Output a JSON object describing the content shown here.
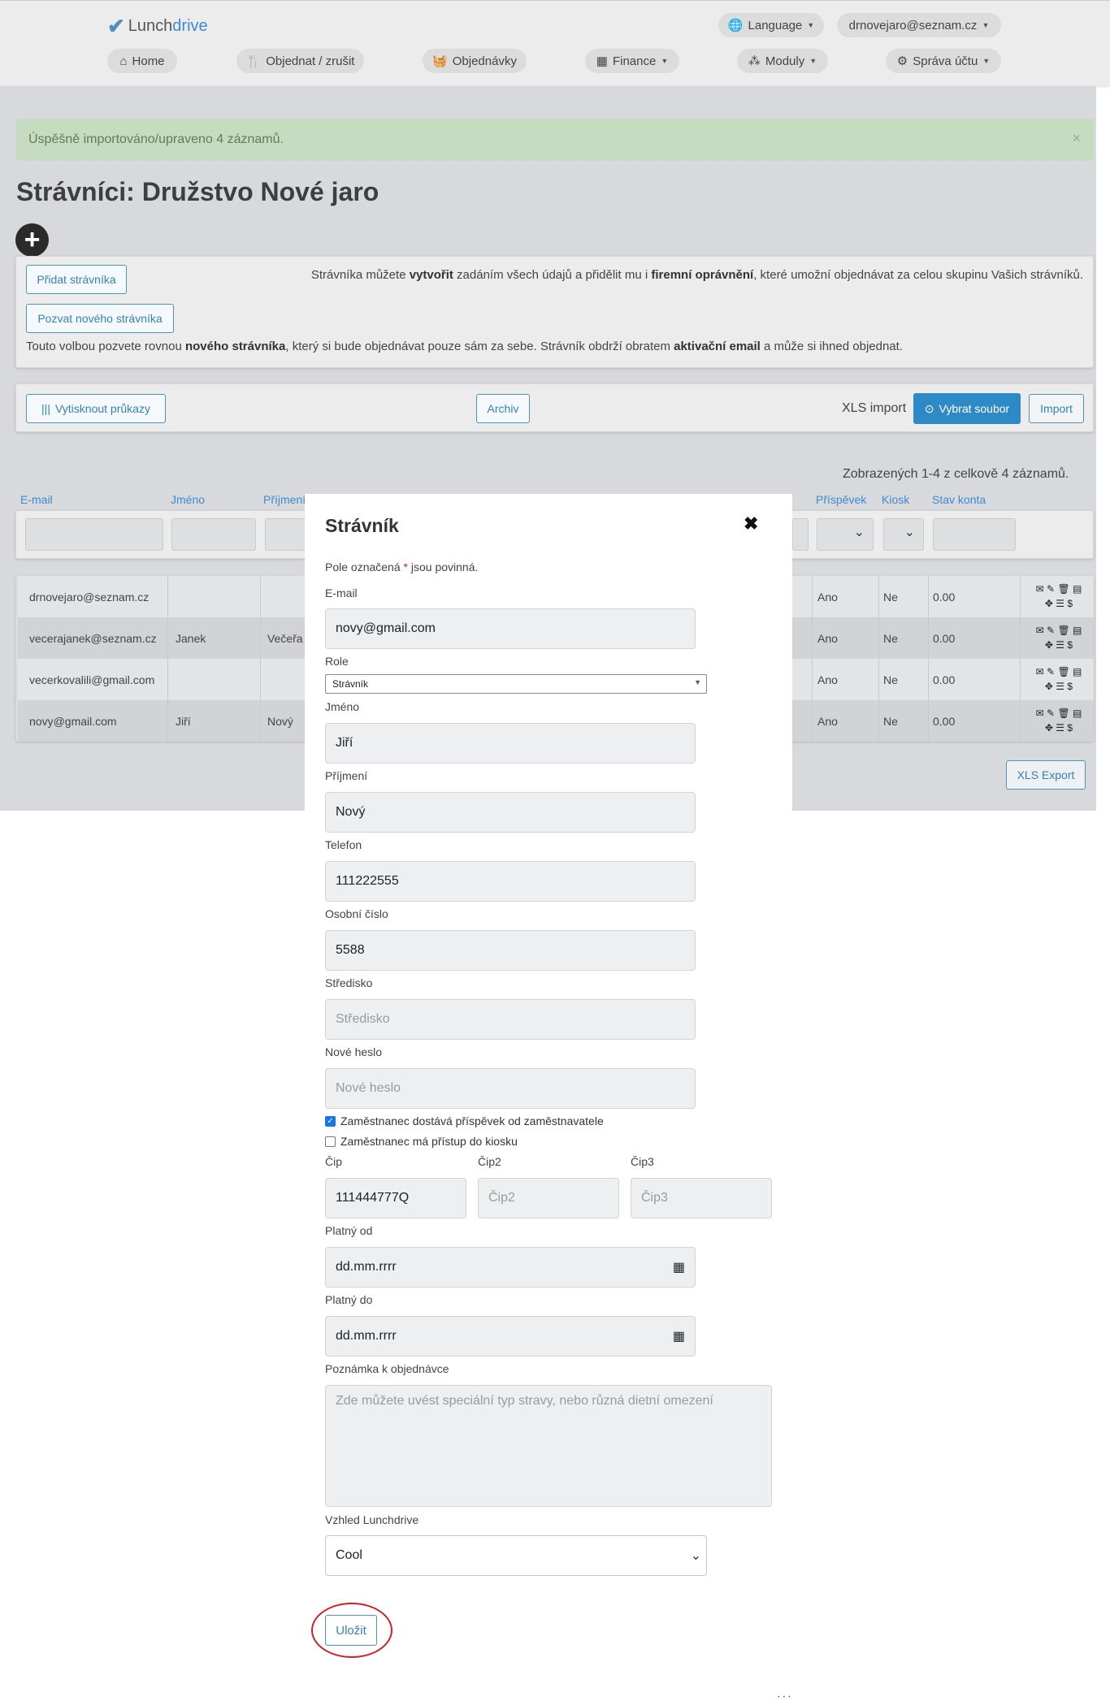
{
  "header": {
    "logo_prefix": "Lunch",
    "logo_suffix": "drive",
    "language_label": "Language",
    "user_label": "drnovejaro@seznam.cz",
    "nav": {
      "home": "Home",
      "order": "Objednat / zrušit",
      "orders": "Objednávky",
      "finance": "Finance",
      "modules": "Moduly",
      "account": "Správa účtu"
    }
  },
  "alert": {
    "message": "Úspěšně importováno/upraveno 4 záznamů.",
    "close": "×"
  },
  "page": {
    "title": "Strávníci: Družstvo Nové jaro"
  },
  "add_panel": {
    "add_button": "Přidat strávníka",
    "invite_button": "Pozvat nového strávníka",
    "add_text_1": "Strávníka můžete ",
    "add_text_bold_1": "vytvořit",
    "add_text_2": " zadáním všech údajů a přidělit mu i ",
    "add_text_bold_2": "firemní oprávnění",
    "add_text_3": ", které umožní objednávat za celou skupinu Vašich strávníků.",
    "invite_text_1": "Touto volbou pozvete rovnou ",
    "invite_text_bold_1": "nového strávníka",
    "invite_text_2": ", který si bude objednávat pouze sám za sebe. Strávník obdrží obratem ",
    "invite_text_bold_2": "aktivační email",
    "invite_text_3": " a může si ihned objednat."
  },
  "toolbar": {
    "print_cards": "Vytisknout průkazy",
    "archive": "Archiv",
    "xls_import_label": "XLS import",
    "choose_file": "Vybrat soubor",
    "import": "Import",
    "xls_export": "XLS Export"
  },
  "table": {
    "summary": "Zobrazených 1-4 z celkově 4 záznamů.",
    "columns": {
      "email": "E-mail",
      "first_name": "Jméno",
      "last_name": "Příjmení",
      "contribution": "Příspěvek",
      "kiosk": "Kiosk",
      "balance": "Stav konta"
    },
    "rows": [
      {
        "email": "drnovejaro@seznam.cz",
        "first_name": "",
        "last_name": "",
        "contribution": "Ano",
        "kiosk": "Ne",
        "balance": "0.00"
      },
      {
        "email": "vecerajanek@seznam.cz",
        "first_name": "Janek",
        "last_name": "Večeřa",
        "contribution": "Ano",
        "kiosk": "Ne",
        "balance": "0.00"
      },
      {
        "email": "vecerkovalili@gmail.com",
        "first_name": "",
        "last_name": "",
        "contribution": "Ano",
        "kiosk": "Ne",
        "balance": "0.00"
      },
      {
        "email": "novy@gmail.com",
        "first_name": "Jiří",
        "last_name": "Nový",
        "contribution": "Ano",
        "kiosk": "Ne",
        "balance": "0.00"
      }
    ],
    "action_icons": [
      "mail-icon",
      "edit-icon",
      "delete-icon",
      "list-icon",
      "move-icon",
      "card-icon",
      "dollar-icon"
    ]
  },
  "modal": {
    "title": "Strávník",
    "close": "✖",
    "required_note_1": "Pole označená ",
    "required_star": "*",
    "required_note_2": " jsou povinná.",
    "email_label": "E-mail",
    "email_value": "novy@gmail.com",
    "role_label": "Role",
    "role_value": "Strávník",
    "first_name_label": "Jméno",
    "first_name_value": "Jiří",
    "last_name_label": "Příjmení",
    "last_name_value": "Nový",
    "phone_label": "Telefon",
    "phone_value": "111222555",
    "personal_no_label": "Osobní číslo",
    "personal_no_value": "5588",
    "center_label": "Středisko",
    "center_placeholder": "Středisko",
    "password_label": "Nové heslo",
    "password_placeholder": "Nové heslo",
    "contribution_check": "Zaměstnanec dostává příspěvek od zaměstnavatele",
    "contribution_checked": true,
    "kiosk_check": "Zaměstnanec má přístup do kiosku",
    "kiosk_checked": false,
    "chip_label": "Čip",
    "chip_value": "111444777Q",
    "chip2_label": "Čip2",
    "chip2_placeholder": "Čip2",
    "chip3_label": "Čip3",
    "chip3_placeholder": "Čip3",
    "valid_from_label": "Platný od",
    "valid_from_placeholder": "dd.mm.rrrr",
    "valid_to_label": "Platný do",
    "valid_to_placeholder": "dd.mm.rrrr",
    "note_label": "Poznámka k objednávce",
    "note_placeholder": "Zde můžete uvést speciální typ stravy, nebo různá dietní omezení",
    "theme_label": "Vzhled Lunchdrive",
    "theme_value": "Cool",
    "save": "Uložit"
  },
  "colors": {
    "accent": "#3481b9",
    "primary_button": "#2e8ac6",
    "success_bg": "#c6dcc1",
    "highlight_oval": "#d0202a"
  }
}
